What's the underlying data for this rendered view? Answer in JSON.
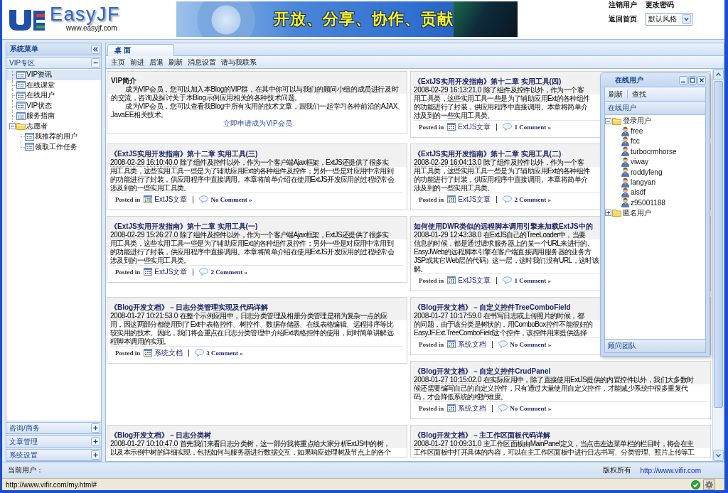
{
  "header": {
    "logo": {
      "name": "EasyJF",
      "url": "www.easyjf.com"
    },
    "banner": {
      "slogan": "开放、分享、协作、贡献"
    },
    "links": [
      {
        "label": "注销用户"
      },
      {
        "label": "更改密码"
      },
      {
        "label": "返回首页"
      }
    ],
    "style_select": {
      "value": "默认风格"
    }
  },
  "sidebar": {
    "title": "系统菜单",
    "sections": [
      {
        "title": "VIP专区",
        "expanded": true,
        "items": [
          {
            "label": "VIP资讯",
            "kind": "leaf",
            "selected": true
          },
          {
            "label": "在线课堂",
            "kind": "leaf",
            "selected": false
          },
          {
            "label": "在线用户",
            "kind": "leaf",
            "selected": false
          },
          {
            "label": "VIP状态",
            "kind": "leaf",
            "selected": false
          },
          {
            "label": "服务指南",
            "kind": "leaf",
            "selected": false
          },
          {
            "label": "志愿者",
            "kind": "folder",
            "expanded": true,
            "selected": false,
            "children": [
              {
                "label": "我推荐的用户",
                "kind": "leaf",
                "selected": false
              },
              {
                "label": "领取工作任务",
                "kind": "leaf",
                "selected": false
              }
            ]
          }
        ]
      },
      {
        "title": "咨询/商务",
        "expanded": false
      },
      {
        "title": "文章管理",
        "expanded": false
      },
      {
        "title": "系统设置",
        "expanded": false
      }
    ]
  },
  "main": {
    "tabs": [
      {
        "label": "桌 面",
        "selected": true
      }
    ],
    "toolbar": [
      {
        "label": "主页"
      },
      {
        "label": "前进"
      },
      {
        "label": "后退"
      },
      {
        "label": "刷新"
      },
      {
        "label": "消息设置"
      },
      {
        "label": "请与我联系"
      }
    ],
    "rows": [
      {
        "left": [
          {
            "kind": "intro",
            "title": "VIP简介",
            "paragraphs": [
              "成为VIP会员，您可以加入本Blog的VIP群，在其中你可以与我们的顾问小组的成员进行及时的交流，咨询及探讨关于本Blog示例应用相关的各种技术问题。",
              "成为VIP会员，您可以查看我Blog中所有实用的技术文章，跟我们一起学习各种前沿的AJAX、JavaEE相关技术。"
            ],
            "link": "立即申请成为VIP会员"
          }
        ],
        "right": [
          {
            "kind": "post",
            "title": "《ExtJS实用开发指南》第十二章 实用工具(四)",
            "date": "2008-02-29 16:13:21.0",
            "excerpt_lines": [
              "除了组件及控件以外，作为一个客",
              "用工具类，这些实用工具一些是为了辅助应用Ext的各种组件",
              "的功能进行了封装，供应用程序中直接调用。本章将简单介",
              "涉及到的一些实用工具类。"
            ],
            "posted_in": "Posted in",
            "category": "ExtJS文章",
            "comments": "1 Comment »"
          }
        ]
      },
      {
        "left": [
          {
            "kind": "post",
            "title": "《ExtJS实用开发指南》第十二章 实用工具(三)",
            "date": "2008-02-29 16:10:40.0",
            "excerpt_lines": [
              "除了组件及控件以外，作为一个客户端Ajax框架，ExtJS还提供了很多实",
              "用工具类，这些实用工具一些是为了辅助应用Ext的各种组件及控件；另外一些是对应用中常用到",
              "的功能进行了封装，供应用程序中直接调用。本章将简单介绍在使用ExtJS开发应用的过程经常会",
              "涉及到的一些实用工具类。"
            ],
            "posted_in": "Posted in",
            "category": "ExtJS文章",
            "comments": "No Comment »"
          }
        ],
        "right": [
          {
            "kind": "post",
            "title": "《ExtJS实用开发指南》第十二章 实用工具(二)",
            "date": "2008-02-29 16:04:13.0",
            "excerpt_lines": [
              "除了组件及控件以外，作为一个客",
              "用工具类，这些实用工具一些是为了辅助应用Ext的各种组件",
              "的功能进行了封装，供应用程序中直接调用。本章将简单介",
              "涉及到的一些实用工具类。"
            ],
            "posted_in": "Posted in",
            "category": "ExtJS文章",
            "comments": "2 Comment »"
          }
        ]
      },
      {
        "left": [
          {
            "kind": "post",
            "title": "《ExtJS实用开发指南》第十二章 实用工具(一)",
            "date": "2008-02-29 15:26:27.0",
            "excerpt_lines": [
              "除了组件及控件以外，作为一个客户端Ajax框架，ExtJS还提供了很多实",
              "用工具类，这些实用工具一些是为了辅助应用Ext的各种组件及控件；另外一些是对应用中常用到",
              "的功能进行了封装，供应用程序中直接调用。本章将简单介绍在使用ExtJS开发应用的过程经常会",
              "涉及到的一些实用工具类。"
            ],
            "posted_in": "Posted in",
            "category": "ExtJS文章",
            "comments": "2 Comment »"
          }
        ],
        "right": [
          {
            "kind": "post",
            "title": "如何使用DWR类似的远程脚本调用引擎来加载ExtJS中的",
            "date": "2008-01-29 12:43:38.0",
            "excerpt_lines": [
              "在ExtJS自己的TreeLoader中，当要",
              "信息的时候，都是通过请求服务器上的某一个URL来进行的。",
              "EasyJWeb的远程脚本引擎在客户端直接调用服务器的业务方",
              "JSP或其它Web层的代码）这一层，这时我们没有URL，这时该",
              "解。"
            ],
            "posted_in": "Posted in",
            "category": "ExtJS文章",
            "comments": "1 Comment »"
          }
        ]
      },
      {
        "left": [
          {
            "kind": "post",
            "title": "《Blog开发文档》－日志分类管理实现及代码详解",
            "date": "2008-01-27 10:21:53.0",
            "excerpt_lines": [
              "在整个示例应用中，日志分类管理及相册分类管理是稍为复杂一点的应",
              "用，因这两部分都使用到了Ext中表格控件、树控件、数据存储器、在线表格编辑、远程排序等比",
              "较实用的技术。因此，我们将会重点在日志分类管理中介绍Ext表格控件的使用，同时简单讲解远",
              "程脚本调用的实现。"
            ],
            "posted_in": "Posted in",
            "category": "系统文档",
            "comments": "3 Comment »"
          }
        ],
        "right": [
          {
            "kind": "post",
            "title": "《Blog开发文档》－自定义控件TreeComboField",
            "date": "2008-01-27 10:17:59.0",
            "excerpt_lines": [
              "在书写日志或上传照片的时候，都",
              "的问题，由于该分类是树状的，用ComboBox控件不能很好的",
              "EasyJF.Ext.TreeComboField这个控件，该控件用来提供选择"
            ],
            "posted_in": "Posted in",
            "category": "系统文档",
            "comments": "No Comment »"
          },
          {
            "kind": "post",
            "title": "《Blog开发文档》－自定义控件CrudPanel",
            "date": "2008-01-27 10:15:02.0",
            "excerpt_lines": [
              "在实际应用中，除了直接使用ExtJS提供的内置控件以外，我们大多数时",
              "候还需要编写自己的自定义控件，只有通过大量使用自定义控件，才能减少系统中很多重复代",
              "码，才会降低系统的维护难度。"
            ],
            "posted_in": "Posted in",
            "category": "系统文档",
            "comments": "No Comment »"
          }
        ]
      },
      {
        "left": [
          {
            "kind": "post",
            "title": "《Blog开发文档》－日志分类树",
            "date": "2008-01-27 10:10:47.0",
            "excerpt_lines": [
              "首先我们来看日志分类树，这一部分我将重点给大家分析ExtJS中的树，",
              "以及本示例中树的详细实现，包括如何与服务器进行数据交互，如果响应处理树及节点上的各个"
            ]
          }
        ],
        "right": [
          {
            "kind": "post",
            "title": "《Blog开发文档》－主工作区面板代码详解",
            "date": "2008-01-27 10:09:31.0",
            "excerpt_lines": [
              "主工作区面板由MainPanel定义，当点击左边菜单栏的栏目时，将会在主",
              "工作区面板中打开具体的内容，可以在主工作区面板中进行日志书写、分类管理、照片上传等工"
            ]
          }
        ]
      }
    ]
  },
  "online_window": {
    "title": "在线用户",
    "toolbar": [
      {
        "label": "刷新"
      },
      {
        "label": "查找"
      }
    ],
    "tree_header": "在线用户",
    "tree": [
      {
        "label": "登录用户",
        "kind": "folder",
        "expanded": true,
        "selected": false,
        "children": [
          {
            "label": "free",
            "kind": "user",
            "selected": false
          },
          {
            "label": "fcc",
            "kind": "user",
            "selected": false
          },
          {
            "label": "turbocrmhorse",
            "kind": "user",
            "selected": false
          },
          {
            "label": "viway",
            "kind": "user",
            "selected": false
          },
          {
            "label": "roddyfeng",
            "kind": "user",
            "selected": false
          },
          {
            "label": "langyan",
            "kind": "user",
            "selected": false
          },
          {
            "label": "aisdf",
            "kind": "user",
            "selected": false
          },
          {
            "label": "z95001188",
            "kind": "user",
            "selected": false
          }
        ]
      },
      {
        "label": "匿名用户",
        "kind": "folder",
        "expanded": false,
        "selected": false
      }
    ],
    "footer_header": "顾问团队"
  },
  "status_bar": {
    "current_user": "当前用户：",
    "copyright": "版权所有",
    "site_link": "http://www.vifir.com"
  },
  "browser_status": {
    "url": "http://www.vifir.com/my.html#"
  }
}
